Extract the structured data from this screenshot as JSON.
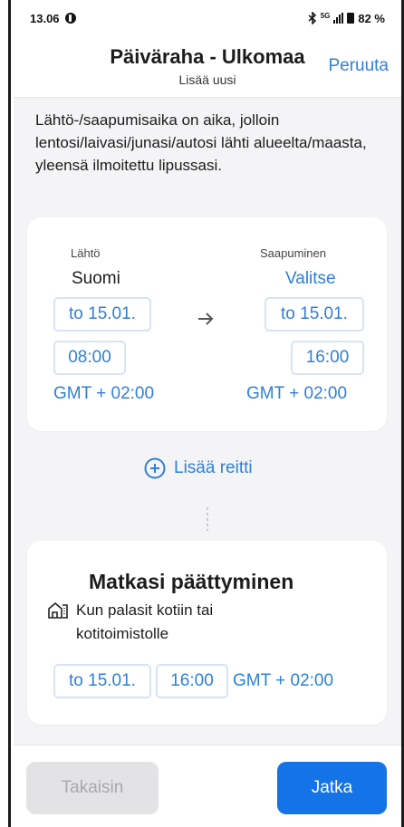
{
  "status_bar": {
    "time": "13.06",
    "network": "5G",
    "battery": "82 %"
  },
  "header": {
    "title": "Päiväraha - Ulkomaa",
    "subtitle": "Lisää uusi",
    "cancel_label": "Peruuta"
  },
  "info_text": "Lähtö-/saapumisaika on aika, jolloin lentosi/laivasi/junasi/autosi lähti alueelta/maasta, yleensä ilmoitettu lipussasi.",
  "route": {
    "departure": {
      "label": "Lähtö",
      "country": "Suomi",
      "date": "to 15.01.",
      "time": "08:00",
      "timezone": "GMT + 02:00"
    },
    "arrival": {
      "label": "Saapuminen",
      "country": "Valitse",
      "date": "to 15.01.",
      "time": "16:00",
      "timezone": "GMT + 02:00"
    }
  },
  "add_route_label": "Lisää reitti",
  "trip_end": {
    "title": "Matkasi päättyminen",
    "description": "Kun palasit kotiin tai kotitoimistolle",
    "date": "to 15.01.",
    "time": "16:00",
    "timezone": "GMT + 02:00"
  },
  "footer": {
    "back_label": "Takaisin",
    "next_label": "Jatka"
  },
  "colors": {
    "accent": "#2f80d9",
    "primary_button": "#1473e6",
    "disabled_button": "#e3e3e6",
    "background": "#f4f4f6"
  },
  "icons": [
    "facebook-icon",
    "bluetooth-icon",
    "signal-icon",
    "battery-icon",
    "arrow-right-icon",
    "plus-circle-icon",
    "home-office-icon"
  ]
}
